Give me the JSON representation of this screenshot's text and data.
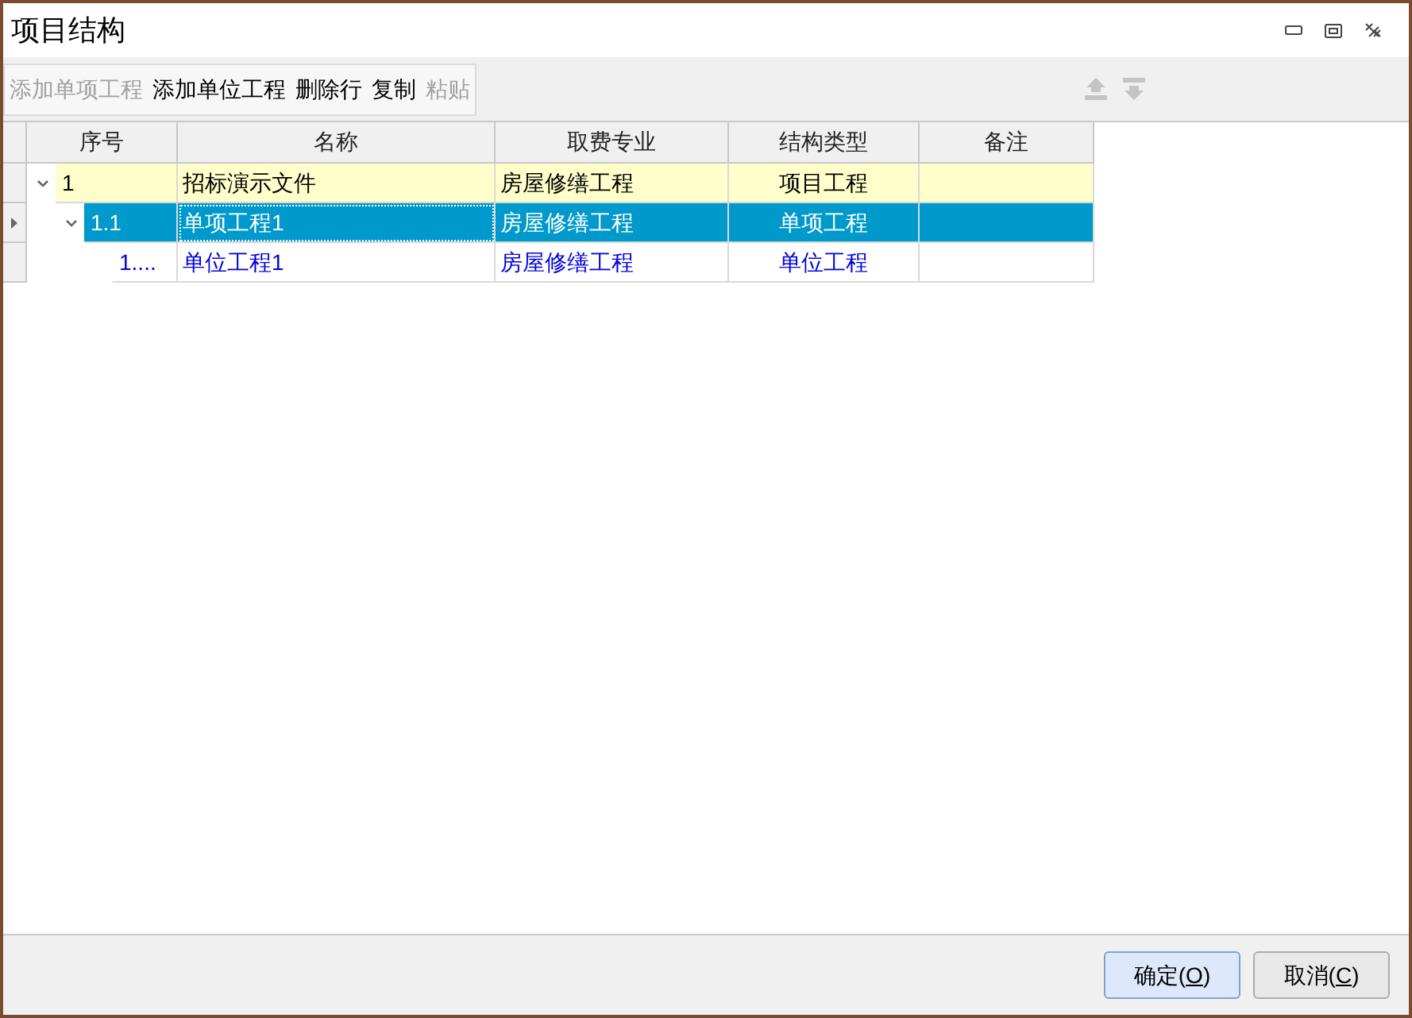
{
  "window": {
    "title": "项目结构"
  },
  "toolbar": [
    {
      "label": "添加单项工程",
      "disabled": true
    },
    {
      "label": "添加单位工程",
      "disabled": false
    },
    {
      "label": "删除行",
      "disabled": false
    },
    {
      "label": "复制",
      "disabled": false
    },
    {
      "label": "粘贴",
      "disabled": true
    }
  ],
  "move_buttons": [
    {
      "kind": "up",
      "disabled": true
    },
    {
      "kind": "down",
      "disabled": true
    }
  ],
  "table": {
    "columns": [
      "序号",
      "名称",
      "取费专业",
      "结构类型",
      "备注"
    ],
    "rows": [
      {
        "kind": "project",
        "selected": false,
        "expanded": true,
        "cells": [
          "1",
          "招标演示文件",
          "房屋修缮工程",
          "项目工程"
        ],
        "children": [
          {
            "selected": true,
            "expanded": true,
            "cells": [
              "1.1",
              "单项工程1",
              "房屋修缮工程",
              "单项工程"
            ],
            "children": [
              {
                "kind": "unit",
                "selected": false,
                "cells": [
                  "1....",
                  "单位工程1",
                  "房屋修缮工程",
                  "单位工程"
                ]
              }
            ]
          }
        ]
      }
    ]
  },
  "buttons": [
    {
      "before": "确定(",
      "key": "O",
      "after": ")",
      "default": true
    },
    {
      "before": "取消(",
      "key": "C",
      "after": ")",
      "default": false
    }
  ]
}
